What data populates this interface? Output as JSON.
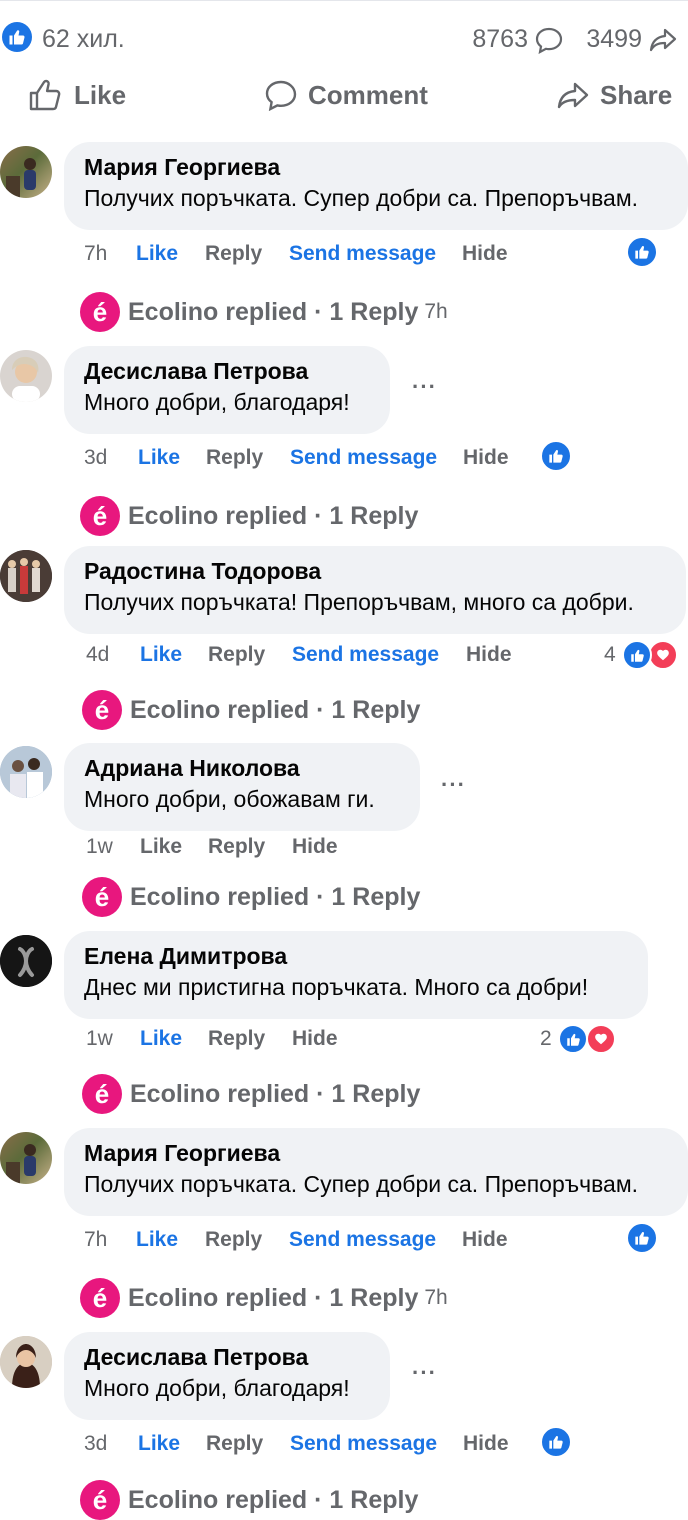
{
  "stats": {
    "reactions": "62 хил.",
    "comments": "8763",
    "shares": "3499"
  },
  "actions": {
    "like": "Like",
    "comment": "Comment",
    "share": "Share"
  },
  "comment_actions": {
    "like": "Like",
    "reply": "Reply",
    "send_message": "Send message",
    "hide": "Hide",
    "more": "···"
  },
  "reply_label": {
    "replied": "Ecolino replied",
    "count": "· 1 Reply"
  },
  "comments": [
    {
      "author": "Мария Георгиева",
      "text": "Получих поръчката. Супер добри са. Препоръчвам.",
      "age": "7h",
      "reply_time": "7h"
    },
    {
      "author": "Десислава Петрова",
      "text": "Много добри, благодаря!",
      "age": "3d"
    },
    {
      "author": "Радостина Тодорова",
      "text": "Получих поръчката! Препоръчвам, много са добри.",
      "age": "4d",
      "reactions": "4"
    },
    {
      "author": "Адриана Николова",
      "text": "Много добри, обожавам ги.",
      "age": "1w"
    },
    {
      "author": "Елена Димитрова",
      "text": "Днес ми пристигна поръчката. Много са добри!",
      "age": "1w",
      "reactions": "2"
    },
    {
      "author": "Мария Георгиева",
      "text": "Получих поръчката. Супер добри са. Препоръчвам.",
      "age": "7h",
      "reply_time": "7h"
    },
    {
      "author": "Десислава Петрова",
      "text": "Много добри, благодаря!",
      "age": "3d"
    }
  ],
  "colors": {
    "accent": "#1b74e4",
    "heart": "#f33e58",
    "ecolino": "#e8177e",
    "bubble": "#f0f2f5"
  },
  "icons": [
    "like-icon",
    "comment-icon",
    "share-icon",
    "heart-icon"
  ]
}
